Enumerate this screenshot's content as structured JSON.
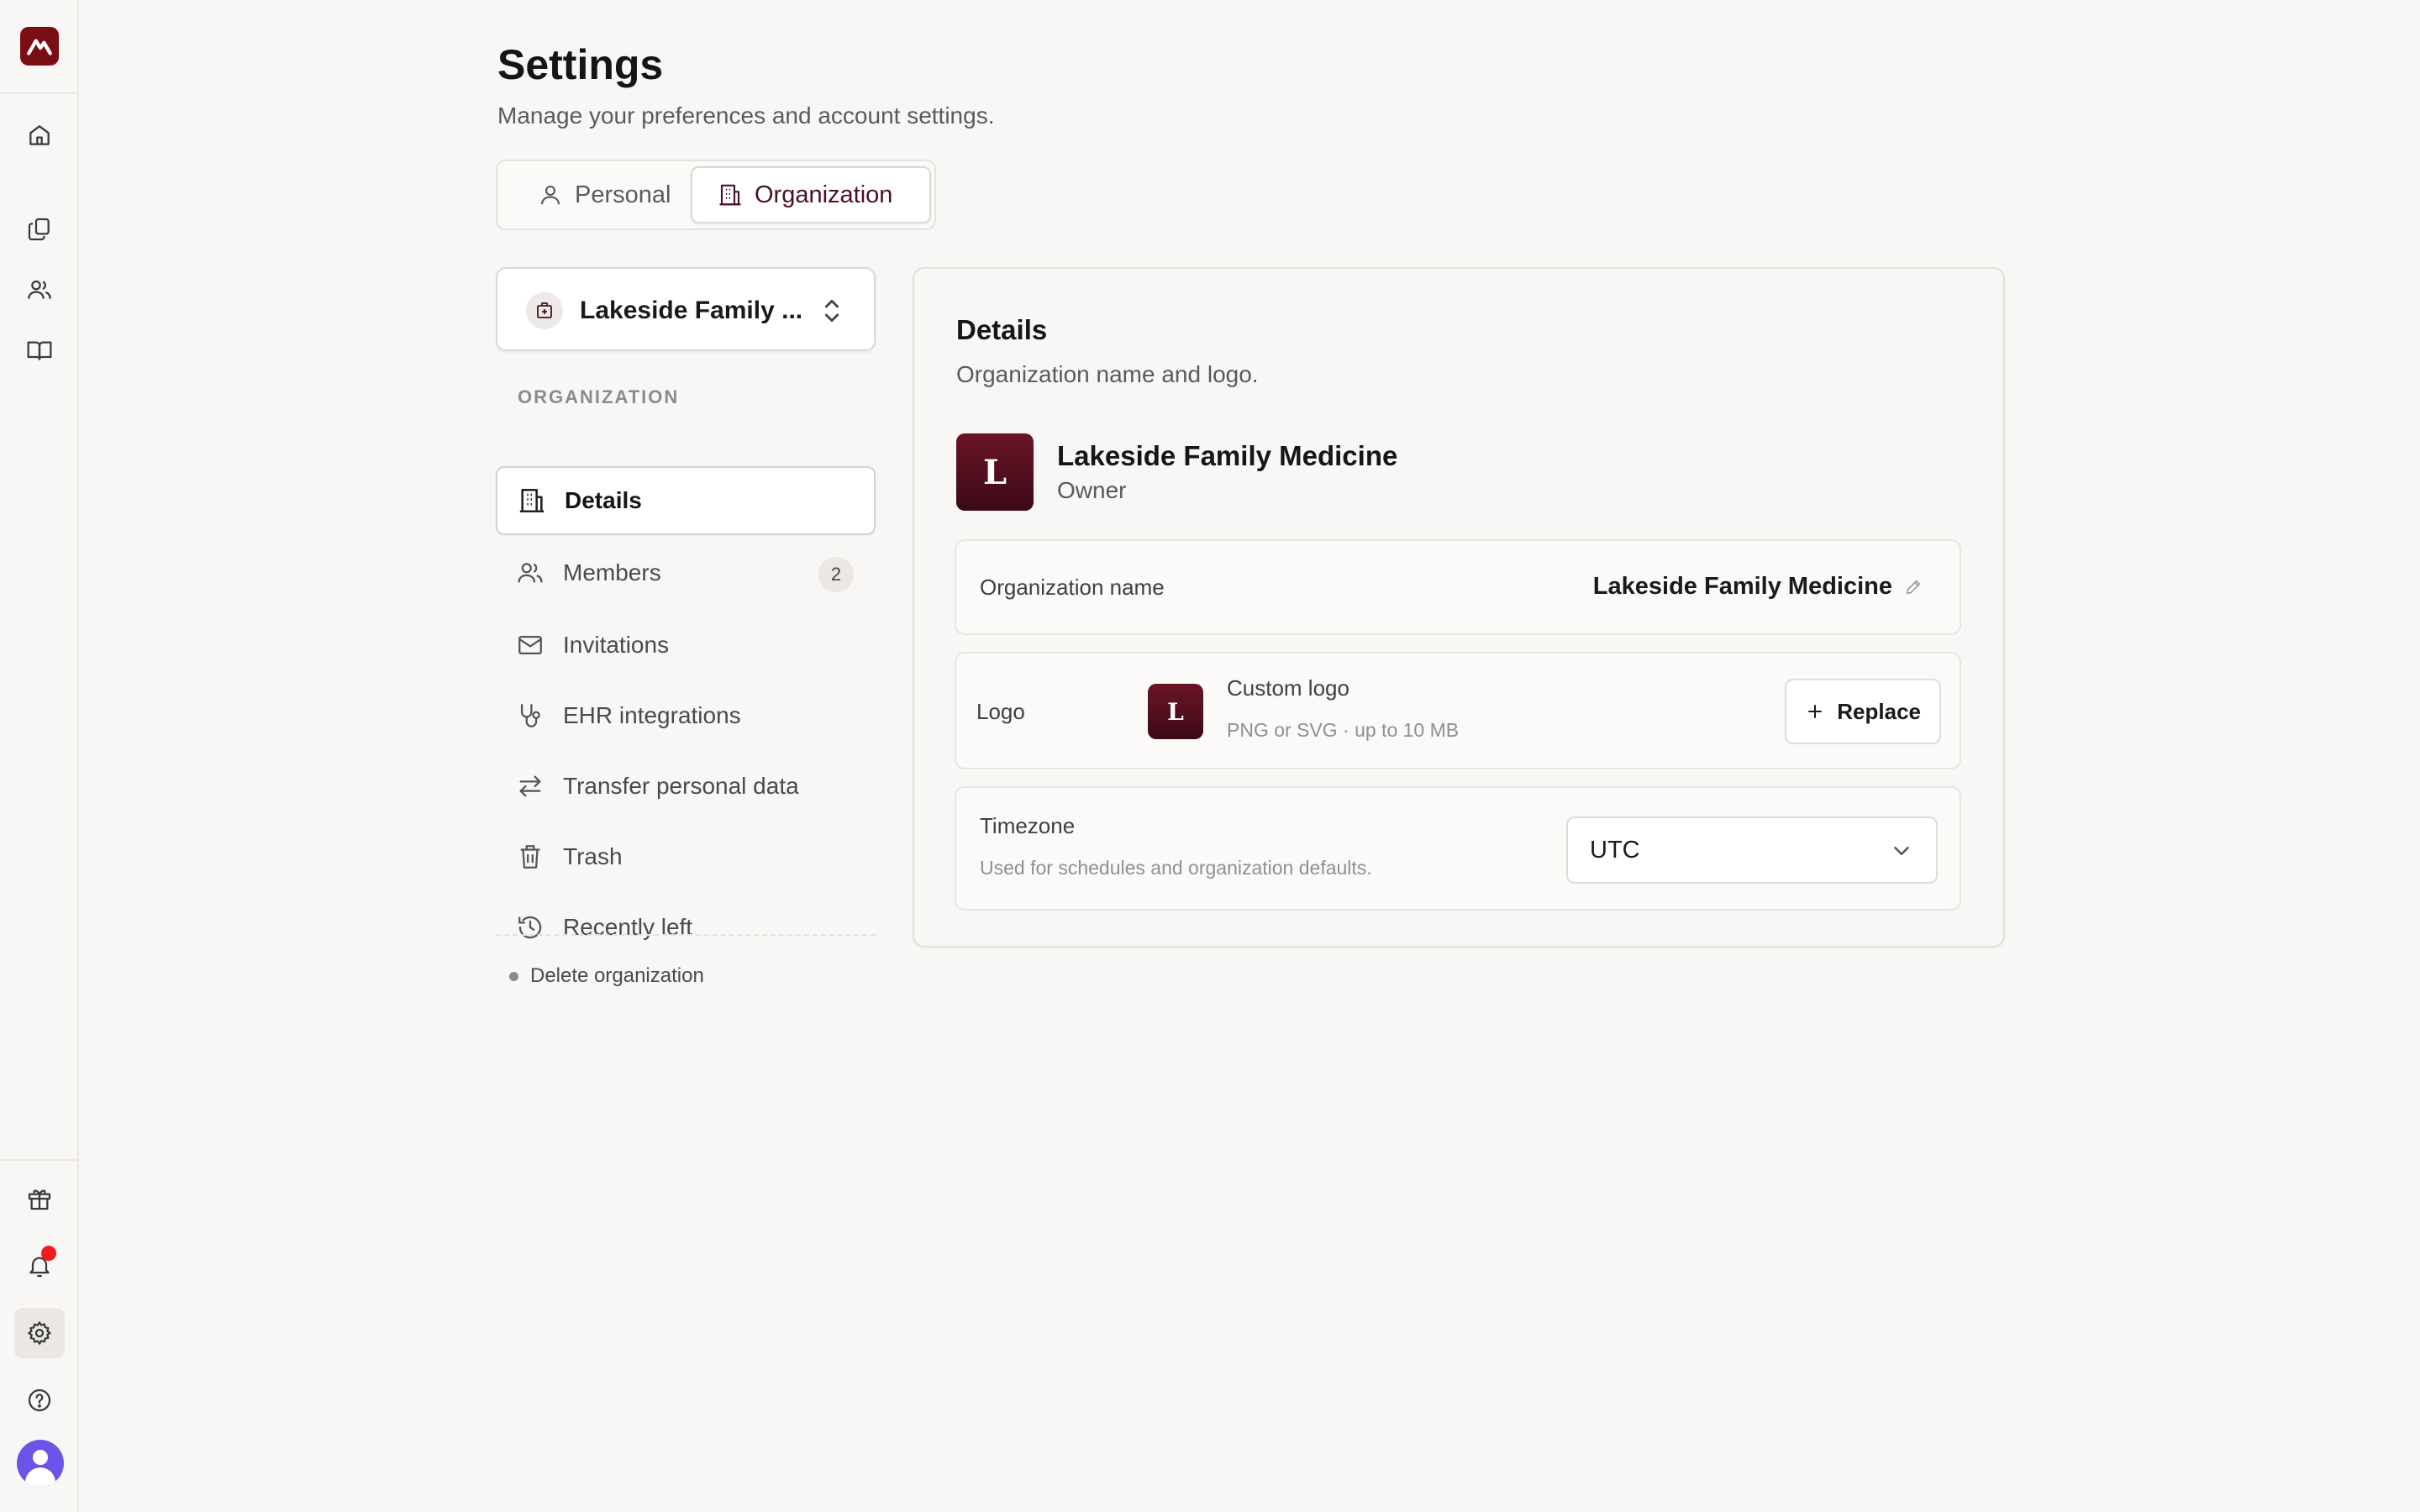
{
  "app": {
    "rail": {
      "logo": "app-logo",
      "nav": [
        "home-icon",
        "documents-icon",
        "users-icon",
        "book-icon"
      ],
      "footer": [
        "gift-icon",
        "bell-icon",
        "gear-icon",
        "help-icon",
        "avatar"
      ],
      "notification_dot_color": "#ee1c1c"
    }
  },
  "header": {
    "title": "Settings",
    "subtitle": "Manage your preferences and account settings."
  },
  "tabs": [
    {
      "label": "Personal",
      "icon": "user-icon",
      "selected": false
    },
    {
      "label": "Organization",
      "icon": "building-icon",
      "selected": true
    }
  ],
  "org_selector": {
    "name": "Lakeside Family ...",
    "icon": "hospital-icon"
  },
  "sidebar": {
    "section_label": "ORGANIZATION",
    "items": [
      {
        "label": "Details",
        "icon": "building-icon",
        "active": true
      },
      {
        "label": "Members",
        "icon": "users-icon",
        "badge": "2"
      },
      {
        "label": "Invitations",
        "icon": "mail-icon"
      },
      {
        "label": "EHR integrations",
        "icon": "stethoscope-icon"
      },
      {
        "label": "Transfer personal data",
        "icon": "transfer-icon"
      },
      {
        "label": "Trash",
        "icon": "trash-icon"
      },
      {
        "label": "Recently left",
        "icon": "history-icon"
      }
    ],
    "delete_label": "Delete organization"
  },
  "details": {
    "title": "Details",
    "subtitle": "Organization name and logo.",
    "org_initial": "L",
    "org_name": "Lakeside Family Medicine",
    "org_role": "Owner",
    "name_row": {
      "label": "Organization name",
      "value": "Lakeside Family Medicine"
    },
    "logo_row": {
      "label": "Logo",
      "initial": "L",
      "title": "Custom logo",
      "hint": "PNG or SVG · up to 10 MB",
      "button": "Replace"
    },
    "timezone_row": {
      "label": "Timezone",
      "hint": "Used for schedules and organization defaults.",
      "value": "UTC"
    },
    "brand_color": "#5a1020"
  }
}
